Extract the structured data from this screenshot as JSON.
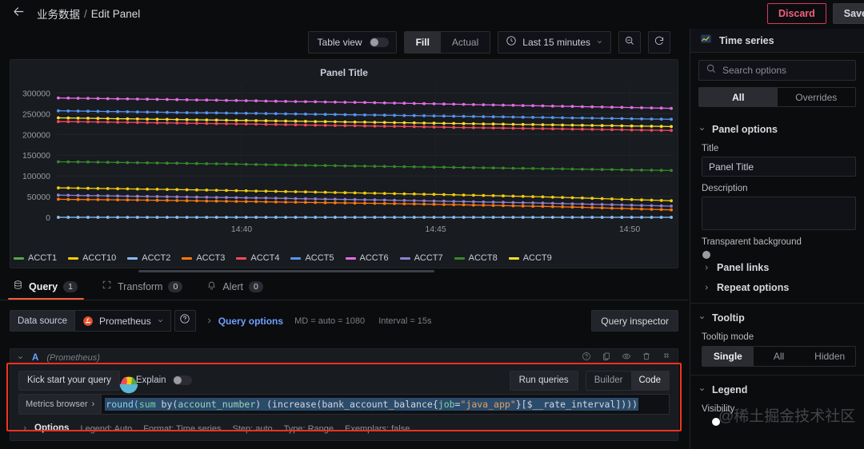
{
  "topbar": {
    "back_icon": "arrow-left-icon",
    "breadcrumb_root": "业务数据",
    "breadcrumb_sep": "/",
    "breadcrumb_leaf": "Edit Panel",
    "discard_label": "Discard",
    "save_label": "Save"
  },
  "panel_toolbar": {
    "table_view_label": "Table view",
    "table_view_on": false,
    "fill_label": "Fill",
    "actual_label": "Actual",
    "fill_active": true,
    "time_range": "Last 15 minutes",
    "clock_icon": "clock-icon",
    "zoom_out_icon": "zoom-out-icon",
    "refresh_icon": "refresh-icon"
  },
  "chart_data": {
    "type": "line",
    "title": "Panel Title",
    "xlabel": "",
    "ylabel": "",
    "ylim": [
      0,
      320000
    ],
    "yticks": [
      0,
      50000,
      100000,
      150000,
      200000,
      250000,
      300000
    ],
    "ytick_labels": [
      "0",
      "50000",
      "100000",
      "150000",
      "200000",
      "250000",
      "300000"
    ],
    "xticks": [
      "14:40",
      "14:45",
      "14:50"
    ],
    "grid": true,
    "legend_position": "bottom",
    "x": [
      "14:37",
      "14:38",
      "14:39",
      "14:40",
      "14:41",
      "14:42",
      "14:43",
      "14:44",
      "14:45",
      "14:46",
      "14:47",
      "14:48",
      "14:49",
      "14:50",
      "14:51"
    ],
    "series": [
      {
        "name": "ACCT1",
        "color": "#56a64b",
        "values": [
          0,
          0,
          0,
          0,
          0,
          0,
          0,
          0,
          0,
          0,
          0,
          0,
          0,
          0,
          0
        ]
      },
      {
        "name": "ACCT10",
        "color": "#f2cc0c",
        "values": [
          71000,
          69500,
          68000,
          66500,
          64500,
          62500,
          60500,
          58500,
          56500,
          54500,
          52000,
          49500,
          46500,
          43000,
          40000
        ]
      },
      {
        "name": "ACCT2",
        "color": "#8ab8ff",
        "values": [
          0,
          0,
          0,
          0,
          0,
          0,
          0,
          0,
          0,
          0,
          0,
          0,
          0,
          0,
          0
        ]
      },
      {
        "name": "ACCT3",
        "color": "#ff780a",
        "values": [
          43500,
          42500,
          41500,
          40000,
          38500,
          37000,
          35500,
          34000,
          32500,
          30500,
          28500,
          26500,
          24000,
          21000,
          18000
        ]
      },
      {
        "name": "ACCT4",
        "color": "#f2495c",
        "values": [
          231000,
          230000,
          228500,
          227000,
          225500,
          224000,
          222000,
          220500,
          219000,
          217000,
          215500,
          214000,
          212500,
          211000,
          209500
        ]
      },
      {
        "name": "ACCT5",
        "color": "#5794f2",
        "values": [
          257000,
          255500,
          254000,
          252500,
          251500,
          250000,
          248500,
          247000,
          245500,
          244000,
          242500,
          241000,
          239500,
          238000,
          236500
        ]
      },
      {
        "name": "ACCT6",
        "color": "#e36ce6",
        "values": [
          288000,
          286500,
          285000,
          283500,
          282000,
          280000,
          278500,
          277000,
          275000,
          273000,
          271000,
          269000,
          267000,
          265000,
          263000
        ]
      },
      {
        "name": "ACCT7",
        "color": "#8f7fd4",
        "values": [
          53500,
          52000,
          50500,
          49000,
          47500,
          46000,
          44000,
          42500,
          40500,
          38500,
          36500,
          34500,
          32000,
          29500,
          27000
        ]
      },
      {
        "name": "ACCT8",
        "color": "#37872d",
        "values": [
          134000,
          133000,
          131500,
          130000,
          128500,
          126500,
          125000,
          123500,
          122000,
          120500,
          119000,
          117500,
          116000,
          114500,
          113000
        ]
      },
      {
        "name": "ACCT9",
        "color": "#fade2a",
        "values": [
          240000,
          238500,
          237000,
          235500,
          234000,
          232500,
          231000,
          229500,
          228000,
          226500,
          225000,
          223500,
          222000,
          220500,
          219000
        ]
      }
    ]
  },
  "tabs": [
    {
      "id": "query",
      "label": "Query",
      "badge": "1",
      "icon": "database-icon",
      "active": true
    },
    {
      "id": "transform",
      "label": "Transform",
      "badge": "0",
      "icon": "transform-icon",
      "active": false
    },
    {
      "id": "alert",
      "label": "Alert",
      "badge": "0",
      "icon": "bell-icon",
      "active": false
    }
  ],
  "query_bar": {
    "data_source_label": "Data source",
    "data_source_value": "Prometheus",
    "help_icon": "help-circle-icon",
    "query_options_label": "Query options",
    "md_meta": "MD = auto = 1080",
    "interval_meta": "Interval = 15s",
    "query_inspector_label": "Query inspector"
  },
  "query_editor": {
    "ref_id": "A",
    "datasource_note": "(Prometheus)",
    "header_icons": [
      "help-circle-icon",
      "duplicate-icon",
      "eye-icon",
      "trash-icon",
      "drag-handle-icon"
    ],
    "kick_start_label": "Kick start your query",
    "explain_label": "Explain",
    "explain_on": false,
    "run_queries_label": "Run queries",
    "builder_label": "Builder",
    "code_label": "Code",
    "code_active": true,
    "metrics_browser_label": "Metrics browser",
    "expression": "round(sum by(account_number) (increase(bank_account_balance{job=\"java_app\"}[$__rate_interval])))",
    "expr_tokens": [
      {
        "t": "round(",
        "c": "fn"
      },
      {
        "t": "sum",
        "c": "kw"
      },
      {
        "t": " by(",
        "c": "plain"
      },
      {
        "t": "account_number",
        "c": "arg"
      },
      {
        "t": ") (",
        "c": "plain"
      },
      {
        "t": "increase(",
        "c": "plain"
      },
      {
        "t": "bank_account_balance{",
        "c": "plain"
      },
      {
        "t": "job",
        "c": "lbl"
      },
      {
        "t": "=",
        "c": "plain"
      },
      {
        "t": "\"java_app\"",
        "c": "str"
      },
      {
        "t": "}[",
        "c": "plain"
      },
      {
        "t": "$__rate_interval",
        "c": "var"
      },
      {
        "t": "])))",
        "c": "plain"
      }
    ],
    "options_title": "Options",
    "options_meta": [
      "Legend: Auto",
      "Format: Time series",
      "Step: auto",
      "Type: Range",
      "Exemplars: false"
    ]
  },
  "options_pane": {
    "viz_type": "Time series",
    "viz_icon": "timeseries-icon",
    "search_placeholder": "Search options",
    "filter_tabs": [
      {
        "label": "All",
        "active": true
      },
      {
        "label": "Overrides",
        "active": false
      }
    ],
    "panel_options": {
      "title": "Panel options",
      "title_field_label": "Title",
      "title_field_value": "Panel Title",
      "description_label": "Description",
      "description_value": "",
      "transparent_label": "Transparent background",
      "transparent_on": false,
      "panel_links_label": "Panel links",
      "repeat_options_label": "Repeat options"
    },
    "tooltip": {
      "title": "Tooltip",
      "mode_label": "Tooltip mode",
      "modes": [
        {
          "label": "Single",
          "active": true
        },
        {
          "label": "All",
          "active": false
        },
        {
          "label": "Hidden",
          "active": false
        }
      ]
    },
    "legend": {
      "title": "Legend",
      "visibility_label": "Visibility",
      "visibility_on": true
    }
  },
  "watermark": "@稀土掘金技术社区",
  "colors": {
    "accent": "#f55f3e",
    "link": "#6e9fff",
    "danger": "#d8385f",
    "panel_bg": "#181b1f",
    "app_bg": "#0b0c0e",
    "highlight_box": "#f5311f"
  }
}
